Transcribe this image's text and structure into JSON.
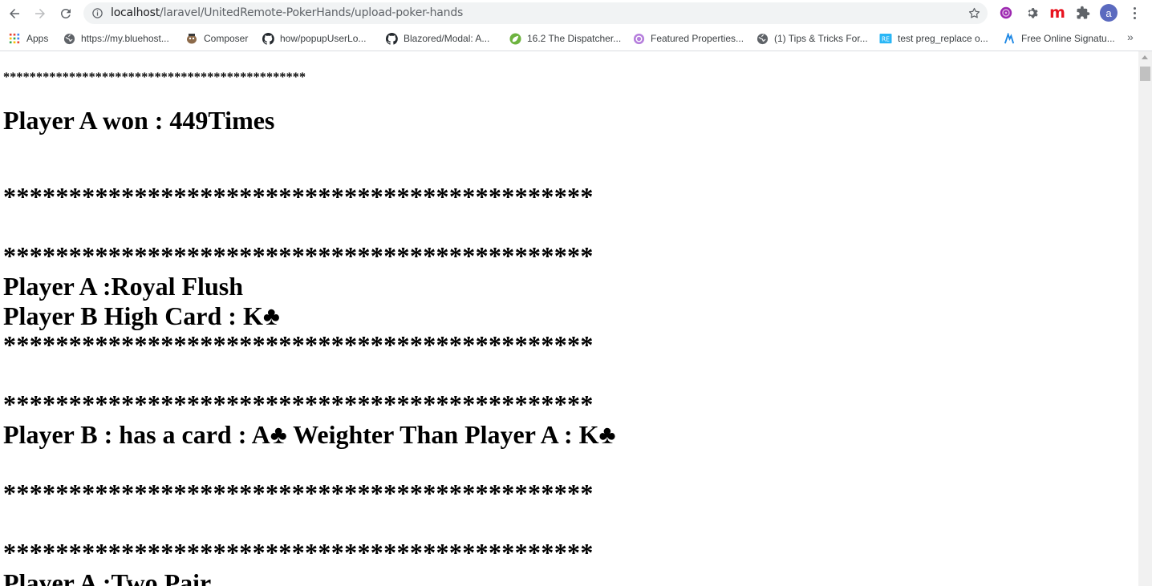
{
  "browser": {
    "url_host": "localhost",
    "url_path": "/laravel/UnitedRemote-PokerHands/upload-poker-hands",
    "avatar_letter": "a",
    "ext_m_label": "m",
    "more_bookmarks": "»"
  },
  "bookmarks": [
    {
      "label": "Apps",
      "icon": "apps-grid-icon"
    },
    {
      "label": "https://my.bluehost...",
      "icon": "globe-icon"
    },
    {
      "label": "Composer",
      "icon": "composer-icon"
    },
    {
      "label": "how/popupUserLo...",
      "icon": "github-icon"
    },
    {
      "label": "Blazored/Modal: A...",
      "icon": "github-icon"
    },
    {
      "label": "16.2 The Dispatcher...",
      "icon": "spring-leaf-icon"
    },
    {
      "label": "Featured Properties...",
      "icon": "purple-badge-icon"
    },
    {
      "label": "(1) Tips & Tricks For...",
      "icon": "globe-icon"
    },
    {
      "label": "test preg_replace o...",
      "icon": "regex-icon"
    },
    {
      "label": "Free Online Signatu...",
      "icon": "signature-icon"
    }
  ],
  "page": {
    "small_stars": "**********************************************",
    "player_a_won": "Player A won : 449Times",
    "stars": "*********************************************",
    "hand1_a": "Player A :Royal Flush",
    "hand1_b": "Player B High Card : K♣",
    "weight_line": "Player B : has a card : A♣ Weighter Than Player A : K♣",
    "hand2_a": "Player A :Two Pair"
  }
}
